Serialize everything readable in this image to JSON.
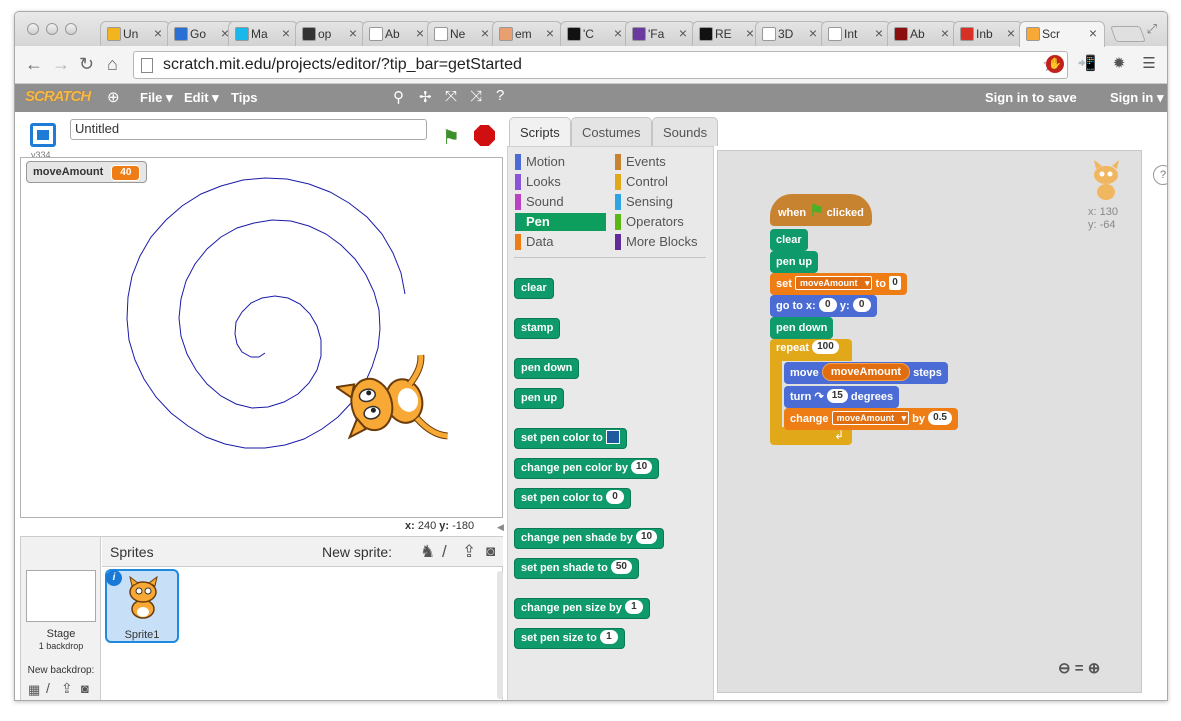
{
  "browser": {
    "tabs": [
      {
        "label": "Un",
        "icon": "yellow-sticky-icon",
        "color": "#f2b51e"
      },
      {
        "label": "Go",
        "icon": "calendar-icon",
        "color": "#2a6fd6"
      },
      {
        "label": "Ma",
        "icon": "vimeo-icon",
        "color": "#1ab7ea"
      },
      {
        "label": "op",
        "icon": "flickr-icon",
        "color": "#333333"
      },
      {
        "label": "Ab",
        "icon": "page-icon",
        "color": "#ffffff"
      },
      {
        "label": "Ne",
        "icon": "page-icon",
        "color": "#ffffff"
      },
      {
        "label": "em",
        "icon": "hand-icon",
        "color": "#e8a070"
      },
      {
        "label": "'C",
        "icon": "theater-icon",
        "color": "#111111"
      },
      {
        "label": "'Fa",
        "icon": "purple-flower-icon",
        "color": "#6a3a9e"
      },
      {
        "label": "RE",
        "icon": "r-logo-icon",
        "color": "#111111"
      },
      {
        "label": "3D",
        "icon": "page-icon",
        "color": "#ffffff"
      },
      {
        "label": "Int",
        "icon": "page-icon",
        "color": "#ffffff"
      },
      {
        "label": "Ab",
        "icon": "blob-icon",
        "color": "#8a1010"
      },
      {
        "label": "Inb",
        "icon": "gmail-icon",
        "color": "#d93025"
      },
      {
        "label": "Scr",
        "icon": "scratch-cat-icon",
        "color": "#f7a835"
      }
    ],
    "url": "scratch.mit.edu/projects/editor/?tip_bar=getStarted"
  },
  "menubar": {
    "logo": "SCRATCH",
    "file": "File ▾",
    "edit": "Edit ▾",
    "tips": "Tips",
    "sign_in_save": "Sign in to save",
    "sign_in": "Sign in ▾"
  },
  "stage": {
    "version": "v334",
    "project_title": "Untitled",
    "monitor_name": "moveAmount",
    "monitor_value": "40",
    "mouse_x_label": "x:",
    "mouse_x": "240",
    "mouse_y_label": "y:",
    "mouse_y": "-180"
  },
  "sprites_panel": {
    "title": "Sprites",
    "new_sprite": "New sprite:",
    "stage_label": "Stage",
    "backdrop_count": "1 backdrop",
    "new_backdrop": "New backdrop:",
    "sprite_name": "Sprite1"
  },
  "tabs": {
    "scripts": "Scripts",
    "costumes": "Costumes",
    "sounds": "Sounds"
  },
  "categories": [
    {
      "label": "Motion",
      "color": "#4a6cd4"
    },
    {
      "label": "Events",
      "color": "#c88330"
    },
    {
      "label": "Looks",
      "color": "#8a55d7"
    },
    {
      "label": "Control",
      "color": "#e1a91a"
    },
    {
      "label": "Sound",
      "color": "#bb42c3"
    },
    {
      "label": "Sensing",
      "color": "#2ca5e2"
    },
    {
      "label": "Pen",
      "color": "#0e9a6b"
    },
    {
      "label": "Operators",
      "color": "#5cb712"
    },
    {
      "label": "Data",
      "color": "#ee7d16"
    },
    {
      "label": "More Blocks",
      "color": "#632d99"
    }
  ],
  "palette_blocks": {
    "clear": "clear",
    "stamp": "stamp",
    "pen_down": "pen down",
    "pen_up": "pen up",
    "set_color_swatch": "set pen color to",
    "change_color": "change pen color by",
    "change_color_val": "10",
    "set_color_num": "set pen color to",
    "set_color_num_val": "0",
    "change_shade": "change pen shade by",
    "change_shade_val": "10",
    "set_shade": "set pen shade to",
    "set_shade_val": "50",
    "change_size": "change pen size by",
    "change_size_val": "1",
    "set_size": "set pen size to",
    "set_size_val": "1"
  },
  "script": {
    "when": "when",
    "clicked": "clicked",
    "clear": "clear",
    "pen_up": "pen up",
    "set": "set",
    "set_var": "moveAmount",
    "to": "to",
    "set_val": "0",
    "goto": "go to x:",
    "goto_x": "0",
    "goto_y_label": "y:",
    "goto_y": "0",
    "pen_down": "pen down",
    "repeat": "repeat",
    "repeat_val": "100",
    "move": "move",
    "move_var": "moveAmount",
    "steps": "steps",
    "turn": "turn",
    "turn_val": "15",
    "degrees": "degrees",
    "change": "change",
    "change_var": "moveAmount",
    "by": "by",
    "change_val": "0.5"
  },
  "sprite_position": {
    "x_label": "x:",
    "x": "130",
    "y_label": "y:",
    "y": "-64"
  }
}
